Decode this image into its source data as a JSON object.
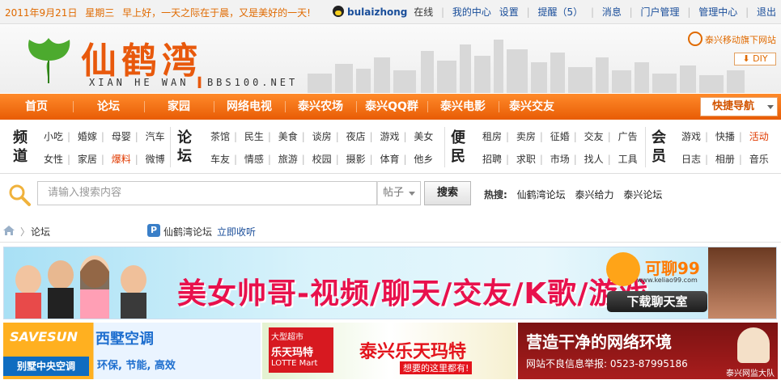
{
  "topbar": {
    "date": "2011年9月21日",
    "weekday": "星期三",
    "greeting": "早上好，一天之际在于晨，又是美好的一天!",
    "username": "bulaizhong",
    "online": "在线",
    "links": [
      "我的中心",
      "设置",
      "提醒（5）",
      "消息",
      "门户管理",
      "管理中心",
      "退出"
    ]
  },
  "banner": {
    "logo": "仙鹤湾",
    "subtitle_left": "XIAN HE WAN",
    "subtitle_right": "BBS100.NET",
    "mobile": "泰兴移动旗下网站",
    "diy": "DIY"
  },
  "nav": {
    "items": [
      "首页",
      "论坛",
      "家园",
      "网络电视",
      "泰兴农场",
      "泰兴QQ群",
      "泰兴电影",
      "泰兴交友"
    ],
    "quick": "快捷导航"
  },
  "channels": {
    "groups": [
      {
        "title": "频道",
        "row1": [
          "小吃",
          "婚嫁",
          "母婴",
          "汽车"
        ],
        "row2": [
          "女性",
          "家居",
          "爆料",
          "微博"
        ]
      },
      {
        "title": "论坛",
        "row1": [
          "茶馆",
          "民生",
          "美食",
          "谈房",
          "夜店",
          "游戏",
          "美女"
        ],
        "row2": [
          "车友",
          "情感",
          "旅游",
          "校园",
          "摄影",
          "体育",
          "他乡"
        ]
      },
      {
        "title": "便民",
        "row1": [
          "租房",
          "卖房",
          "征婚",
          "交友",
          "广告"
        ],
        "row2": [
          "招聘",
          "求职",
          "市场",
          "找人",
          "工具"
        ]
      },
      {
        "title": "会员",
        "row1": [
          "游戏",
          "快播",
          "活动"
        ],
        "row2": [
          "日志",
          "相册",
          "音乐"
        ]
      }
    ]
  },
  "search": {
    "placeholder": "请输入搜索内容",
    "type": "帖子",
    "button": "搜索",
    "hot_label": "热搜:",
    "hot_items": [
      "仙鹤湾论坛",
      "泰兴给力",
      "泰兴论坛"
    ]
  },
  "breadcrumb": {
    "current": "论坛",
    "forum": "仙鹤湾论坛",
    "favorite": "立即收听"
  },
  "ads": {
    "ad1": {
      "headline": "美女帅哥-视频/聊天/交友/K歌/游戏",
      "brand": "可聊99",
      "url": "www.keliao99.com",
      "button": "下载聊天室"
    },
    "ad2": {
      "brand": "SAVESUN",
      "tag": "别墅中央空调",
      "title": "西墅空调",
      "sub": "环保, 节能, 高效"
    },
    "ad3": {
      "brand": "乐天玛特",
      "brand_en": "LOTTE Mart",
      "brand_top": "大型超市",
      "title": "泰兴乐天玛特",
      "sub": "想要的这里都有!"
    },
    "ad4": {
      "title": "营造干净的网络环境",
      "sub": "网站不良信息举报: 0523-87995186",
      "tag": "泰兴网监大队"
    }
  }
}
